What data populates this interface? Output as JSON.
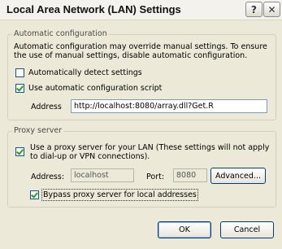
{
  "window": {
    "title": "Local Area Network (LAN) Settings",
    "help_label": "?",
    "close_label": "✕"
  },
  "auto_config": {
    "group_label": "Automatic configuration",
    "description": "Automatic configuration may override manual settings.  To ensure the use of manual settings, disable automatic configuration.",
    "auto_detect": {
      "label": "Automatically detect settings",
      "checked": false
    },
    "use_script": {
      "label": "Use automatic configuration script",
      "checked": true
    },
    "address_label": "Address",
    "address_value": "http://localhost:8080/array.dll?Get.R"
  },
  "proxy": {
    "group_label": "Proxy server",
    "use_proxy": {
      "label": "Use a proxy server for your LAN (These settings will not apply to dial-up or VPN connections).",
      "checked": true
    },
    "address_label": "Address:",
    "address_value": "localhost",
    "port_label": "Port:",
    "port_value": "8080",
    "advanced_label": "Advanced...",
    "bypass": {
      "label": "Bypass proxy server for local addresses",
      "checked": true
    }
  },
  "buttons": {
    "ok_label": "OK",
    "cancel_label": "Cancel"
  }
}
